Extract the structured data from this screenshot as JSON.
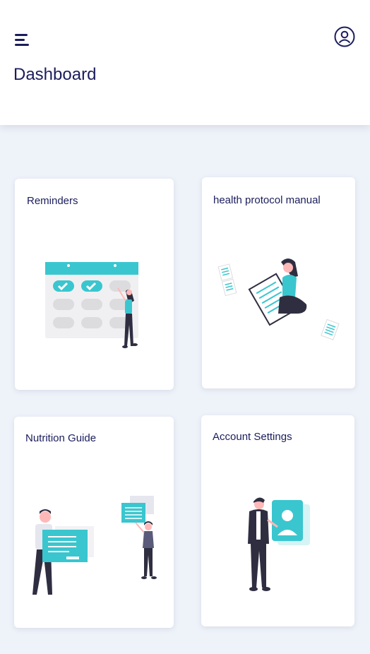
{
  "header": {
    "title": "Dashboard",
    "menu_icon": "hamburger-menu-icon",
    "profile_icon": "user-profile-icon"
  },
  "cards": [
    {
      "title": "Reminders",
      "illustration": "calendar-illustration"
    },
    {
      "title": "health protocol manual",
      "illustration": "document-reading-illustration"
    },
    {
      "title": "Nutrition Guide",
      "illustration": "presentation-illustration"
    },
    {
      "title": "Account Settings",
      "illustration": "profile-card-illustration"
    }
  ],
  "colors": {
    "primary": "#1b1d5c",
    "accent": "#3ac6cf",
    "background": "#eef2f9",
    "card": "#ffffff"
  }
}
